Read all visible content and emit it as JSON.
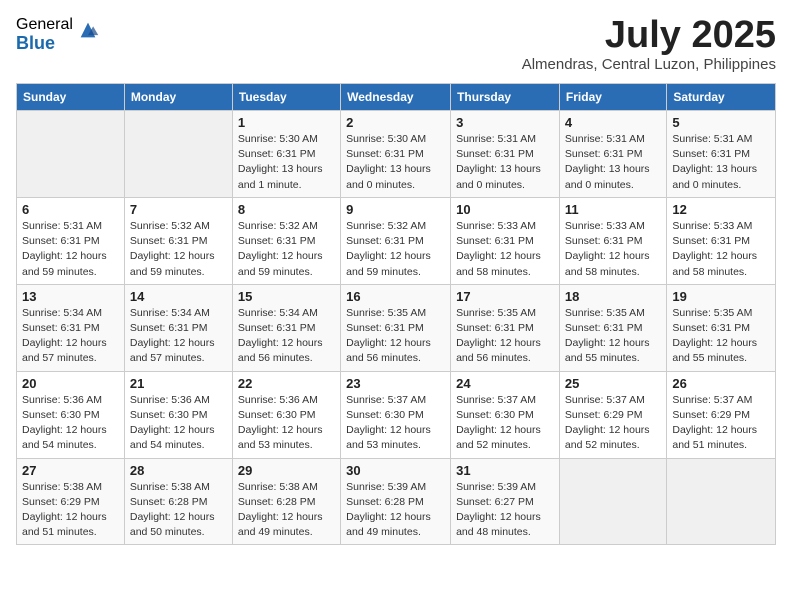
{
  "logo": {
    "general": "General",
    "blue": "Blue"
  },
  "title": "July 2025",
  "location": "Almendras, Central Luzon, Philippines",
  "days_of_week": [
    "Sunday",
    "Monday",
    "Tuesday",
    "Wednesday",
    "Thursday",
    "Friday",
    "Saturday"
  ],
  "weeks": [
    [
      {
        "day": "",
        "info": ""
      },
      {
        "day": "",
        "info": ""
      },
      {
        "day": "1",
        "info": "Sunrise: 5:30 AM\nSunset: 6:31 PM\nDaylight: 13 hours\nand 1 minute."
      },
      {
        "day": "2",
        "info": "Sunrise: 5:30 AM\nSunset: 6:31 PM\nDaylight: 13 hours\nand 0 minutes."
      },
      {
        "day": "3",
        "info": "Sunrise: 5:31 AM\nSunset: 6:31 PM\nDaylight: 13 hours\nand 0 minutes."
      },
      {
        "day": "4",
        "info": "Sunrise: 5:31 AM\nSunset: 6:31 PM\nDaylight: 13 hours\nand 0 minutes."
      },
      {
        "day": "5",
        "info": "Sunrise: 5:31 AM\nSunset: 6:31 PM\nDaylight: 13 hours\nand 0 minutes."
      }
    ],
    [
      {
        "day": "6",
        "info": "Sunrise: 5:31 AM\nSunset: 6:31 PM\nDaylight: 12 hours\nand 59 minutes."
      },
      {
        "day": "7",
        "info": "Sunrise: 5:32 AM\nSunset: 6:31 PM\nDaylight: 12 hours\nand 59 minutes."
      },
      {
        "day": "8",
        "info": "Sunrise: 5:32 AM\nSunset: 6:31 PM\nDaylight: 12 hours\nand 59 minutes."
      },
      {
        "day": "9",
        "info": "Sunrise: 5:32 AM\nSunset: 6:31 PM\nDaylight: 12 hours\nand 59 minutes."
      },
      {
        "day": "10",
        "info": "Sunrise: 5:33 AM\nSunset: 6:31 PM\nDaylight: 12 hours\nand 58 minutes."
      },
      {
        "day": "11",
        "info": "Sunrise: 5:33 AM\nSunset: 6:31 PM\nDaylight: 12 hours\nand 58 minutes."
      },
      {
        "day": "12",
        "info": "Sunrise: 5:33 AM\nSunset: 6:31 PM\nDaylight: 12 hours\nand 58 minutes."
      }
    ],
    [
      {
        "day": "13",
        "info": "Sunrise: 5:34 AM\nSunset: 6:31 PM\nDaylight: 12 hours\nand 57 minutes."
      },
      {
        "day": "14",
        "info": "Sunrise: 5:34 AM\nSunset: 6:31 PM\nDaylight: 12 hours\nand 57 minutes."
      },
      {
        "day": "15",
        "info": "Sunrise: 5:34 AM\nSunset: 6:31 PM\nDaylight: 12 hours\nand 56 minutes."
      },
      {
        "day": "16",
        "info": "Sunrise: 5:35 AM\nSunset: 6:31 PM\nDaylight: 12 hours\nand 56 minutes."
      },
      {
        "day": "17",
        "info": "Sunrise: 5:35 AM\nSunset: 6:31 PM\nDaylight: 12 hours\nand 56 minutes."
      },
      {
        "day": "18",
        "info": "Sunrise: 5:35 AM\nSunset: 6:31 PM\nDaylight: 12 hours\nand 55 minutes."
      },
      {
        "day": "19",
        "info": "Sunrise: 5:35 AM\nSunset: 6:31 PM\nDaylight: 12 hours\nand 55 minutes."
      }
    ],
    [
      {
        "day": "20",
        "info": "Sunrise: 5:36 AM\nSunset: 6:30 PM\nDaylight: 12 hours\nand 54 minutes."
      },
      {
        "day": "21",
        "info": "Sunrise: 5:36 AM\nSunset: 6:30 PM\nDaylight: 12 hours\nand 54 minutes."
      },
      {
        "day": "22",
        "info": "Sunrise: 5:36 AM\nSunset: 6:30 PM\nDaylight: 12 hours\nand 53 minutes."
      },
      {
        "day": "23",
        "info": "Sunrise: 5:37 AM\nSunset: 6:30 PM\nDaylight: 12 hours\nand 53 minutes."
      },
      {
        "day": "24",
        "info": "Sunrise: 5:37 AM\nSunset: 6:30 PM\nDaylight: 12 hours\nand 52 minutes."
      },
      {
        "day": "25",
        "info": "Sunrise: 5:37 AM\nSunset: 6:29 PM\nDaylight: 12 hours\nand 52 minutes."
      },
      {
        "day": "26",
        "info": "Sunrise: 5:37 AM\nSunset: 6:29 PM\nDaylight: 12 hours\nand 51 minutes."
      }
    ],
    [
      {
        "day": "27",
        "info": "Sunrise: 5:38 AM\nSunset: 6:29 PM\nDaylight: 12 hours\nand 51 minutes."
      },
      {
        "day": "28",
        "info": "Sunrise: 5:38 AM\nSunset: 6:28 PM\nDaylight: 12 hours\nand 50 minutes."
      },
      {
        "day": "29",
        "info": "Sunrise: 5:38 AM\nSunset: 6:28 PM\nDaylight: 12 hours\nand 49 minutes."
      },
      {
        "day": "30",
        "info": "Sunrise: 5:39 AM\nSunset: 6:28 PM\nDaylight: 12 hours\nand 49 minutes."
      },
      {
        "day": "31",
        "info": "Sunrise: 5:39 AM\nSunset: 6:27 PM\nDaylight: 12 hours\nand 48 minutes."
      },
      {
        "day": "",
        "info": ""
      },
      {
        "day": "",
        "info": ""
      }
    ]
  ]
}
